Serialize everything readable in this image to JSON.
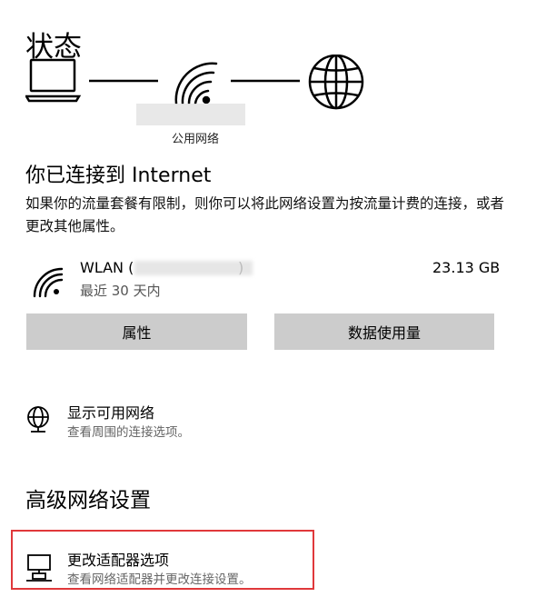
{
  "page": {
    "title": "状态"
  },
  "network_diagram": {
    "nodes": [
      {
        "icon": "laptop-icon"
      },
      {
        "icon": "wifi-icon"
      },
      {
        "icon": "globe-icon"
      }
    ],
    "network_name_suffix": "公用网络"
  },
  "status": {
    "heading": "你已连接到 Internet",
    "description": "如果你的流量套餐有限制，则你可以将此网络设置为按流量计费的连接，或者更改其他属性。"
  },
  "connection": {
    "icon": "wifi-icon",
    "name": "WLAN (",
    "name_suffix": ")",
    "period": "最近 30 天内",
    "usage": "23.13 GB"
  },
  "buttons": {
    "properties": "属性",
    "data_usage": "数据使用量"
  },
  "show_networks": {
    "icon": "globe-network-icon",
    "title": "显示可用网络",
    "subtitle": "查看周围的连接选项。"
  },
  "advanced": {
    "heading": "高级网络设置",
    "adapter_options": {
      "icon": "network-adapter-icon",
      "title": "更改适配器选项",
      "subtitle": "查看网络适配器并更改连接设置。"
    }
  },
  "colors": {
    "button_bg": "#cccccc",
    "highlight_border": "#e0383b",
    "secondary_text": "#666666"
  }
}
